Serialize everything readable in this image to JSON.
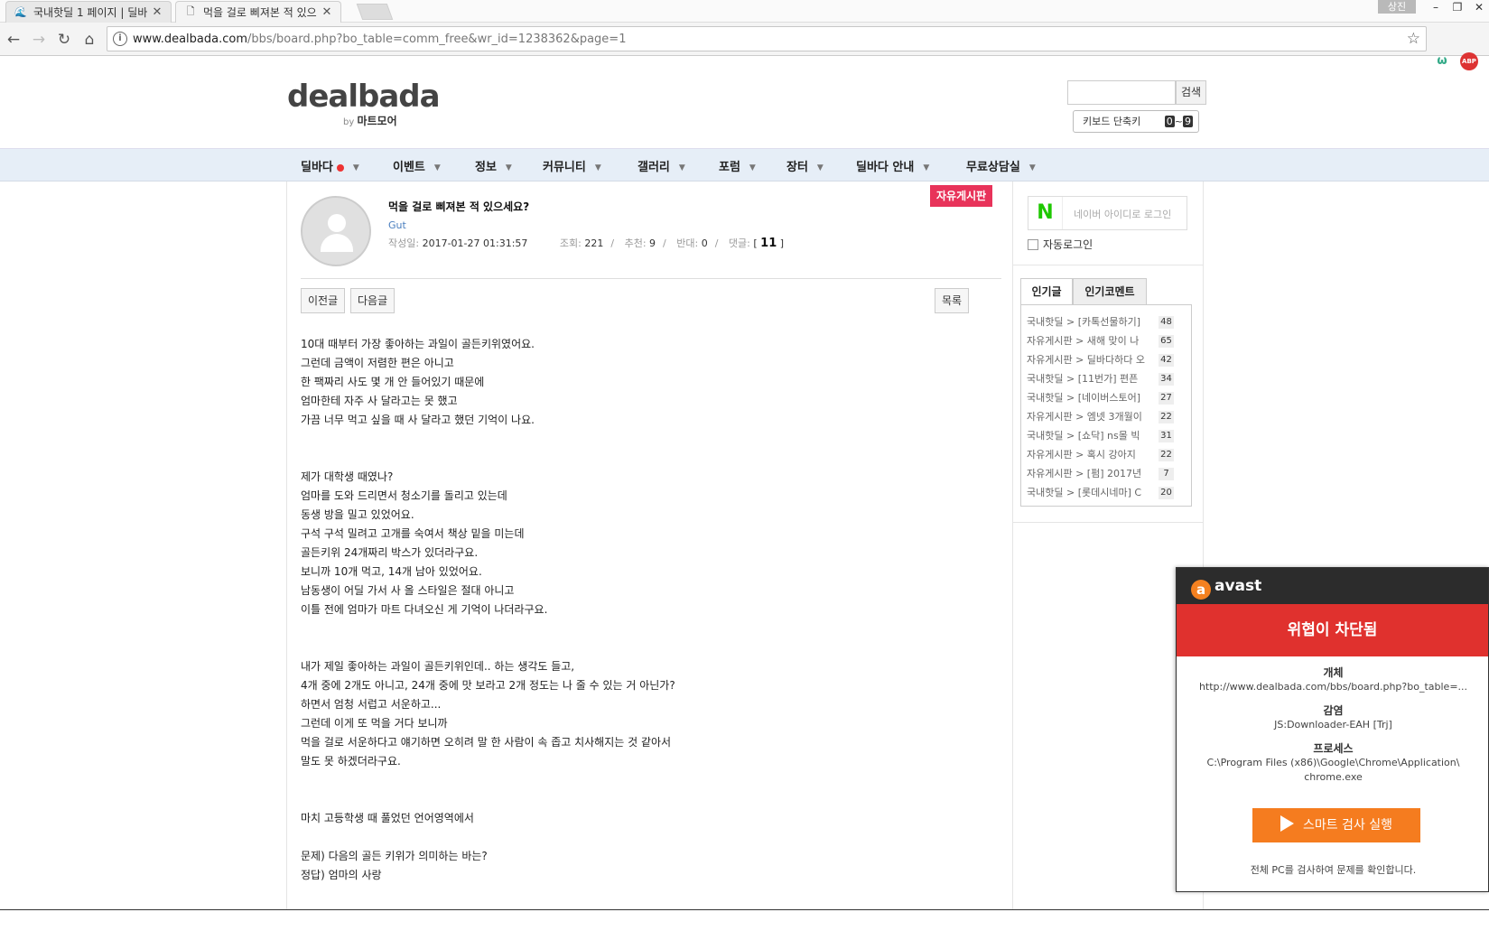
{
  "browser": {
    "tabs": [
      {
        "title": "국내핫딜 1 페이지 | 딜바",
        "active": false
      },
      {
        "title": "먹을 걸로 삐져본 적 있으",
        "active": true
      }
    ],
    "user_badge": "상진",
    "url_domain": "www.dealbada.com",
    "url_path": "/bbs/board.php?bo_table=comm_free&wr_id=1238362&page=1",
    "ext_abp": "ABP"
  },
  "site": {
    "logo": "dealbada",
    "logo_by": "by",
    "logo_sub": "마트모어",
    "search_button": "검색",
    "search_placeholder": "",
    "kbd_label": "키보드 단축키",
    "kbd_key_from": "0",
    "kbd_sep": "~",
    "kbd_key_to": "9"
  },
  "gnb": {
    "items": [
      "딜바다",
      "이벤트",
      "정보",
      "커뮤니티",
      "갤러리",
      "포럼",
      "장터",
      "딜바다 안내",
      "무료상담실"
    ]
  },
  "post": {
    "board_label": "자유게시판",
    "title": "먹을 걸로 삐져본 적 있으세요?",
    "author": "Gut",
    "date_label": "작성일:",
    "date": "2017-01-27 01:31:57",
    "views_label": "조회:",
    "views": "221",
    "likes_label": "추천:",
    "likes": "9",
    "dislikes_label": "반대:",
    "dislikes": "0",
    "comments_label": "댓글:",
    "comments_open": "[",
    "comments": "11",
    "comments_close": "]",
    "sep": "/",
    "prev_button": "이전글",
    "next_button": "다음글",
    "list_button": "목록",
    "body": [
      "10대 때부터 가장 좋아하는 과일이 골든키위였어요.",
      "그런데 금액이 저렴한 편은 아니고",
      "한 팩짜리 사도 몇 개 안 들어있기 때문에",
      "엄마한테 자주 사 달라고는 못 했고",
      "가끔 너무 먹고 싶을 때 사 달라고 했던 기억이 나요.",
      "",
      "",
      "제가 대학생 때였나?",
      "엄마를 도와 드리면서 청소기를 돌리고 있는데",
      "동생 방을 밀고 있었어요.",
      "구석 구석 밀려고 고개를 숙여서 책상 밑을 미는데",
      "골든키위 24개짜리 박스가 있더라구요.",
      "보니까 10개 먹고, 14개 남아 있었어요.",
      "남동생이 어딜 가서  사 올 스타일은 절대 아니고",
      "이틀 전에 엄마가 마트 다녀오신 게 기억이 나더라구요.",
      "",
      "",
      "내가 제일 좋아하는 과일이 골든키위인데.. 하는 생각도 들고,",
      "4개 중에 2개도 아니고, 24개 중에 맛 보라고 2개 정도는 나 줄 수 있는 거 아닌가?",
      "하면서 엄청 서럽고 서운하고...",
      "그런데 이게 또 먹을 거다 보니까",
      "먹을 걸로 서운하다고 얘기하면 오히려 말 한 사람이 속 좁고 치사해지는 것 같아서",
      "말도 못 하겠더라구요.",
      "",
      "",
      "마치 고등학생 때 풀었던 언어영역에서",
      "",
      "문제) 다음의 골든 키위가 의미하는 바는?",
      "정답) 엄마의 사랑"
    ]
  },
  "sidebar": {
    "naver_logo": "N",
    "naver_login": "네이버 아이디로 로그인",
    "auto_login": "자동로그인",
    "tab_popular": "인기글",
    "tab_comments": "인기코멘트",
    "popular": [
      {
        "text": "국내핫딜 > [카톡선물하기]",
        "count": "48"
      },
      {
        "text": "자유게시판 > 새해 맞이 나",
        "count": "65"
      },
      {
        "text": "자유게시판 > 딜바다하다 오",
        "count": "42"
      },
      {
        "text": "국내핫딜 > [11번가] 편픈",
        "count": "34"
      },
      {
        "text": "국내핫딜 > [네이버스토어]",
        "count": "27"
      },
      {
        "text": "자유게시판 > 엠넷 3개월이",
        "count": "22"
      },
      {
        "text": "국내핫딜 > [쇼닥] ns몰 빅",
        "count": "31"
      },
      {
        "text": "자유게시판 > 혹시 강아지",
        "count": "22"
      },
      {
        "text": "자유게시판 > [펌] 2017년",
        "count": "7"
      },
      {
        "text": "국내핫딜 > [롯데시네마] C",
        "count": "20"
      }
    ]
  },
  "avast": {
    "brand": "avast",
    "banner": "위협이 차단됨",
    "object_label": "개체",
    "object_value": "http://www.dealbada.com/bbs/board.php?bo_table=...",
    "infection_label": "감염",
    "infection_value": "JS:Downloader-EAH [Trj]",
    "process_label": "프로세스",
    "process_value_1": "C:\\Program Files (x86)\\Google\\Chrome\\Application\\",
    "process_value_2": "chrome.exe",
    "run_button": "스마트 검사 실행",
    "footer": "전체 PC를 검사하여 문제를 확인합니다."
  }
}
